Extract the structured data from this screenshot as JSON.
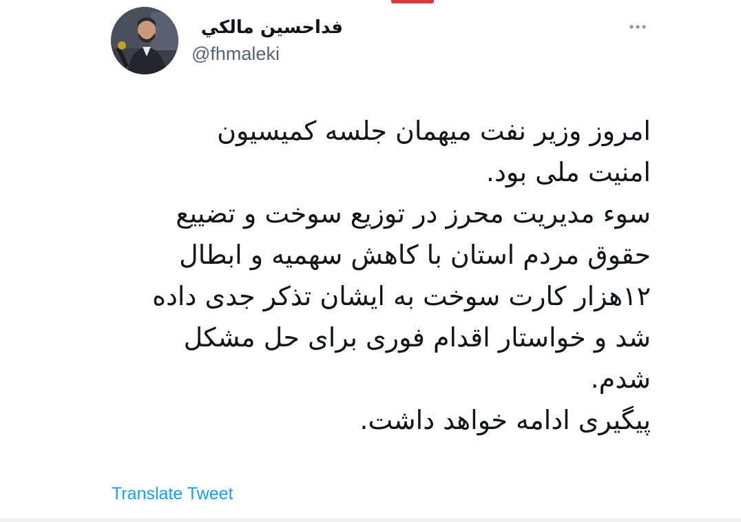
{
  "tweet": {
    "author": {
      "display_name": "فداحسين مالكي",
      "handle": "@fhmaleki"
    },
    "text_lines": [
      "امروز وزیر نفت میهمان جلسه کمیسیون",
      "امنیت ملی بود.",
      " سوء مدیریت محرز در توزیع سوخت و تضییع",
      "حقوق مردم استان با کاهش سهمیه  و ابطال",
      "۱۲هزار کارت سوخت به ایشان تذکر جدی داده",
      "شد  و خواستار اقدام فوری برای حل مشکل",
      "شدم.",
      "پیگیری ادامه خواهد داشت."
    ],
    "translate_label": "Translate Tweet",
    "more_icon": "more-horizontal-icon"
  },
  "colors": {
    "text": "#0f1419",
    "secondary": "#536471",
    "link": "#1d9bf0",
    "accent": "#d63a3a"
  }
}
